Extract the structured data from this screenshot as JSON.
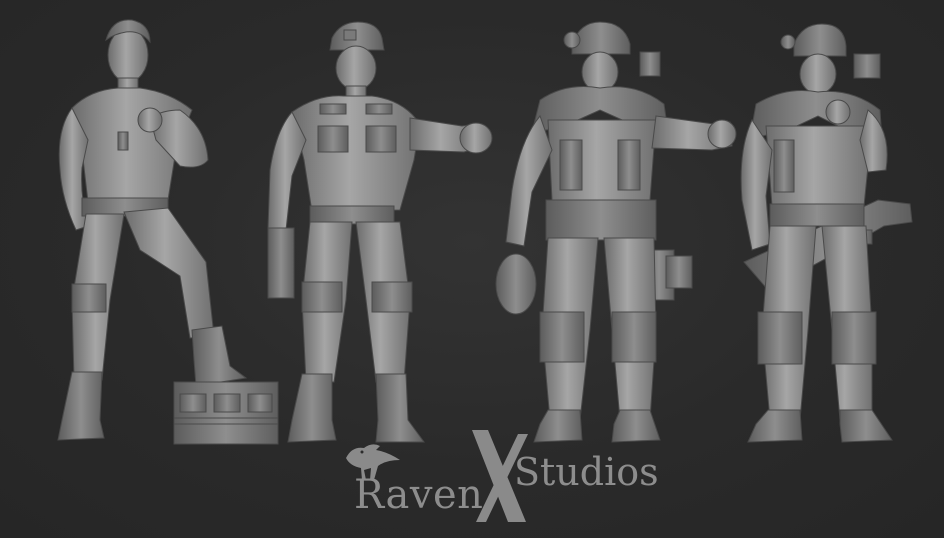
{
  "image": {
    "background_color": "#2b2b2b",
    "model_color": "#9a9a9a"
  },
  "figures": [
    {
      "label": "figure-1-casual-soldier"
    },
    {
      "label": "figure-2-uniformed-officer"
    },
    {
      "label": "figure-3-armored-soldier-with-motion-tracker"
    },
    {
      "label": "figure-4-armored-soldier-with-rifle"
    }
  ],
  "logo": {
    "word_left": "Raven",
    "word_right": "Studios",
    "emblem_letter": "X",
    "text_color": "#8d8d8d"
  }
}
